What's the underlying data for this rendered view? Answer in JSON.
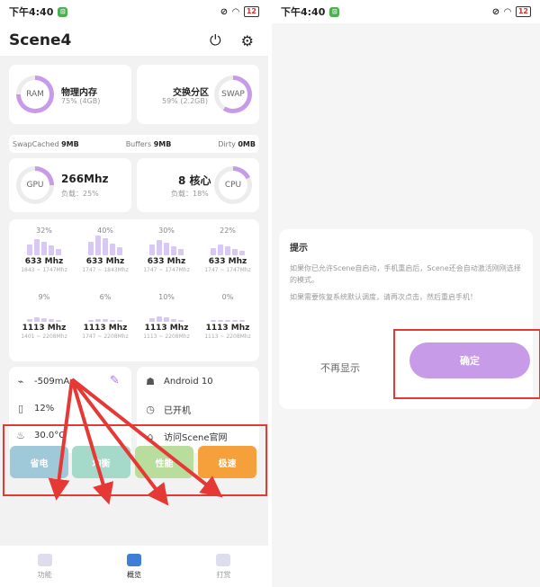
{
  "status_bar": {
    "time": "下午4:40",
    "badge": "⊡",
    "battery": "12"
  },
  "left": {
    "app_title": "Scene4",
    "memory": {
      "ram": {
        "ring_label": "RAM",
        "title": "物理内存",
        "sub": "75% (4GB)",
        "percent": 75
      },
      "swap": {
        "ring_label": "SWAP",
        "title": "交换分区",
        "sub": "59% (2.2GB)",
        "percent": 59
      }
    },
    "stats": [
      {
        "label": "SwapCached",
        "value": "9MB"
      },
      {
        "label": "Buffers",
        "value": "9MB"
      },
      {
        "label": "Dirty",
        "value": "0MB"
      }
    ],
    "gpu": {
      "ring_label": "GPU",
      "freq": "266Mhz",
      "load": "负载：25%",
      "percent": 25
    },
    "cpu": {
      "ring_label": "CPU",
      "cores": "8 核心",
      "load": "负载：18%",
      "percent": 18
    },
    "cores": [
      {
        "pct": "32%",
        "freq": "633 Mhz",
        "range": "1843 ~ 1747Mhz",
        "level": 0.32
      },
      {
        "pct": "40%",
        "freq": "633 Mhz",
        "range": "1747 ~ 1843Mhz",
        "level": 0.4
      },
      {
        "pct": "30%",
        "freq": "633 Mhz",
        "range": "1747 ~ 1747Mhz",
        "level": 0.3
      },
      {
        "pct": "22%",
        "freq": "633 Mhz",
        "range": "1747 ~ 1747Mhz",
        "level": 0.22
      },
      {
        "pct": "9%",
        "freq": "1113 Mhz",
        "range": "1401 ~ 2208Mhz",
        "level": 0.09
      },
      {
        "pct": "6%",
        "freq": "1113 Mhz",
        "range": "1747 ~ 2208Mhz",
        "level": 0.06
      },
      {
        "pct": "10%",
        "freq": "1113 Mhz",
        "range": "1113 ~ 2208Mhz",
        "level": 0.1
      },
      {
        "pct": "0%",
        "freq": "1113 Mhz",
        "range": "1113 ~ 2208Mhz",
        "level": 0.0
      }
    ],
    "battery_info": {
      "current": "-509mA",
      "level": "12%",
      "temp": "30.0°C"
    },
    "system_info": {
      "android": "Android 10",
      "uptime": "已开机",
      "visit": "访问Scene官网"
    },
    "modes": [
      {
        "label": "省电",
        "color": "#9fc8d8"
      },
      {
        "label": "均衡",
        "color": "#a5d9c9"
      },
      {
        "label": "性能",
        "color": "#b9dd9d"
      },
      {
        "label": "极速",
        "color": "#f5a03a"
      }
    ],
    "nav": [
      {
        "label": "功能"
      },
      {
        "label": "概览"
      },
      {
        "label": "打赏"
      }
    ],
    "accent": "#c89be8",
    "highlight": "#e53935"
  },
  "right": {
    "dialog_title": "提示",
    "dialog_msg_1": "如果你已允许Scene自启动，手机重启后，Scene还会自动激活刚刚选择的模式。",
    "dialog_msg_2": "如果需要恢复系统默认调度，请再次点击，然后重启手机！",
    "btn_dont_show": "不再显示",
    "btn_ok": "确定"
  }
}
